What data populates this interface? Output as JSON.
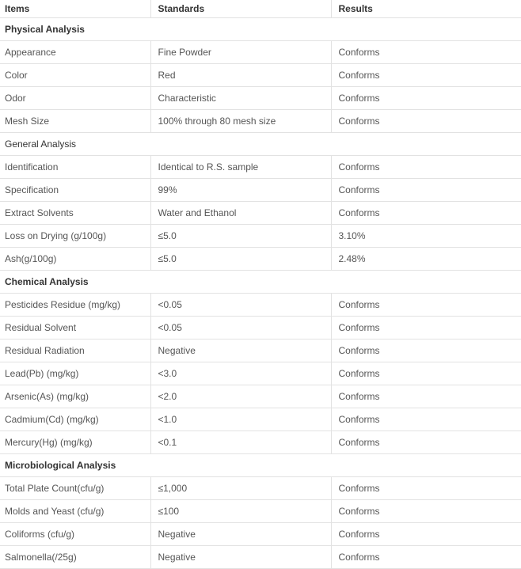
{
  "table": {
    "headers": [
      "Items",
      "Standards",
      "Results"
    ],
    "sections": [
      {
        "title": "Physical Analysis",
        "bold": true,
        "rows": [
          [
            "Appearance",
            "Fine Powder",
            "Conforms"
          ],
          [
            "Color",
            "Red",
            "Conforms"
          ],
          [
            "Odor",
            "Characteristic",
            "Conforms"
          ],
          [
            "Mesh Size",
            "100% through 80 mesh size",
            "Conforms"
          ]
        ]
      },
      {
        "title": "General Analysis",
        "bold": false,
        "rows": [
          [
            "Identification",
            "Identical to R.S. sample",
            "Conforms"
          ],
          [
            "Specification",
            "99%",
            "Conforms"
          ],
          [
            "Extract Solvents",
            "Water and Ethanol",
            "Conforms"
          ],
          [
            "Loss on Drying (g/100g)",
            "≤5.0",
            "3.10%"
          ],
          [
            "Ash(g/100g)",
            "≤5.0",
            "2.48%"
          ]
        ]
      },
      {
        "title": "Chemical Analysis",
        "bold": true,
        "rows": [
          [
            "Pesticides Residue (mg/kg)",
            "<0.05",
            "Conforms"
          ],
          [
            "Residual Solvent",
            "<0.05",
            "Conforms"
          ],
          [
            "Residual Radiation",
            "Negative",
            "Conforms"
          ],
          [
            "Lead(Pb) (mg/kg)",
            "<3.0",
            "Conforms"
          ],
          [
            "Arsenic(As) (mg/kg)",
            "<2.0",
            "Conforms"
          ],
          [
            "Cadmium(Cd) (mg/kg)",
            "<1.0",
            "Conforms"
          ],
          [
            "Mercury(Hg) (mg/kg)",
            "<0.1",
            "Conforms"
          ]
        ]
      },
      {
        "title": "Microbiological Analysis",
        "bold": true,
        "rows": [
          [
            "Total Plate Count(cfu/g)",
            "≤1,000",
            "Conforms"
          ],
          [
            "Molds and Yeast (cfu/g)",
            "≤100",
            "Conforms"
          ],
          [
            "Coliforms (cfu/g)",
            "Negative",
            "Conforms"
          ],
          [
            "Salmonella(/25g)",
            "Negative",
            "Conforms"
          ]
        ]
      }
    ]
  }
}
